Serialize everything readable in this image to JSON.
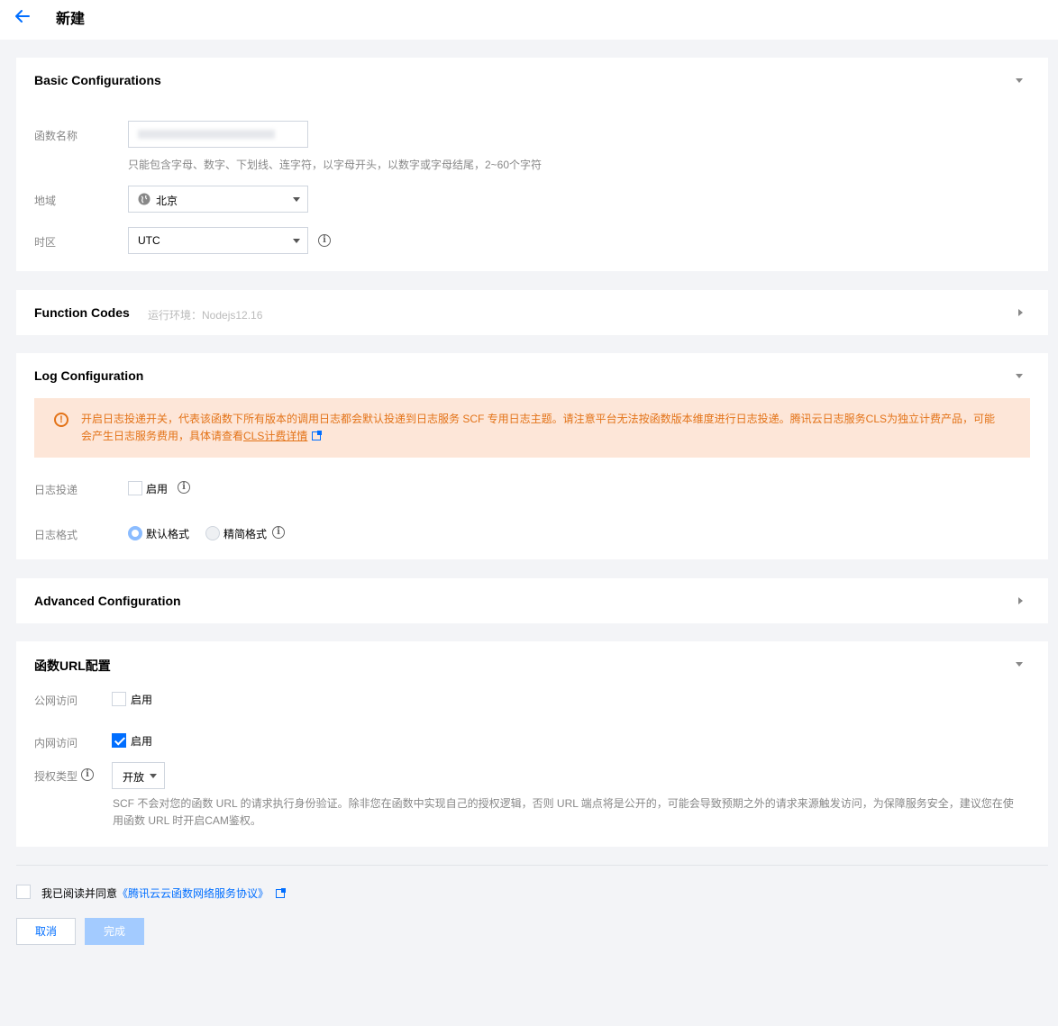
{
  "header": {
    "title": "新建"
  },
  "basic": {
    "title": "Basic Configurations",
    "function_name": {
      "label": "函数名称",
      "value": "",
      "help": "只能包含字母、数字、下划线、连字符，以字母开头，以数字或字母结尾，2~60个字符"
    },
    "region": {
      "label": "地域",
      "value": "北京"
    },
    "timezone": {
      "label": "时区",
      "value": "UTC"
    }
  },
  "function_codes": {
    "title": "Function Codes",
    "runtime_note": "运行环境：Nodejs12.16"
  },
  "log": {
    "title": "Log Configuration",
    "alert_text": "开启日志投递开关，代表该函数下所有版本的调用日志都会默认投递到日志服务 SCF 专用日志主题。请注意平台无法按函数版本维度进行日志投递。腾讯云日志服务CLS为独立计费产品，可能会产生日志服务费用，具体请查看",
    "alert_link": "CLS计费详情",
    "delivery_label": "日志投递",
    "delivery_option": "启用",
    "format_label": "日志格式",
    "format_default": "默认格式",
    "format_simple": "精简格式"
  },
  "advanced": {
    "title": "Advanced Configuration"
  },
  "url_config": {
    "title": "函数URL配置",
    "public_label": "公网访问",
    "public_option": "启用",
    "private_label": "内网访问",
    "private_option": "启用",
    "auth_label": "授权类型",
    "auth_value": "开放",
    "auth_help": "SCF 不会对您的函数 URL 的请求执行身份验证。除非您在函数中实现自己的授权逻辑，否则 URL 端点将是公开的，可能会导致预期之外的请求来源触发访问，为保障服务安全，建议您在使用函数 URL 时开启CAM鉴权。"
  },
  "footer": {
    "agree_text": "我已阅读并同意",
    "agree_link": "《腾讯云云函数网络服务协议》",
    "cancel": "取消",
    "done": "完成"
  },
  "colors": {
    "accent": "#006eff",
    "warning": "#e37318",
    "warning_bg": "#fde6d8"
  }
}
